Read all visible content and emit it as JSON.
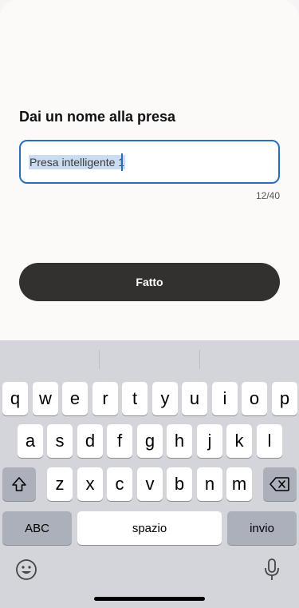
{
  "dialog": {
    "title": "Dai un nome alla presa",
    "name_value": "Presa intelligente 1",
    "counter": "12/40",
    "done_label": "Fatto"
  },
  "keyboard": {
    "row1": [
      "q",
      "w",
      "e",
      "r",
      "t",
      "y",
      "u",
      "i",
      "o",
      "p"
    ],
    "row2": [
      "a",
      "s",
      "d",
      "f",
      "g",
      "h",
      "j",
      "k",
      "l"
    ],
    "row3": [
      "z",
      "x",
      "c",
      "v",
      "b",
      "n",
      "m"
    ],
    "abc_label": "ABC",
    "space_label": "spazio",
    "return_label": "invio"
  },
  "icons": {
    "shift": "shift-icon",
    "backspace": "backspace-icon",
    "emoji": "emoji-icon",
    "mic": "microphone-icon"
  }
}
